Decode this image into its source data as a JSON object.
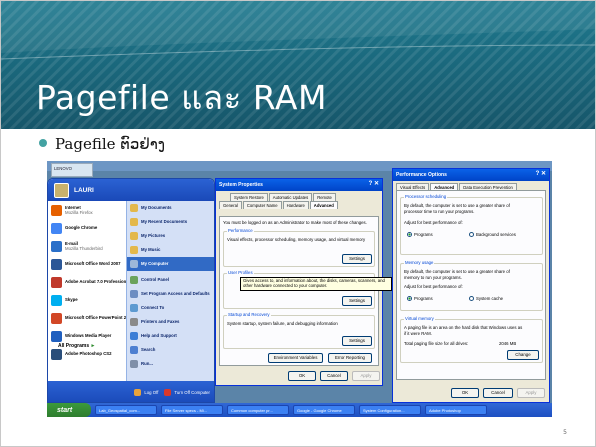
{
  "slide": {
    "title": "Pagefile และ RAM",
    "bullet": "Pagefile ຕົວຢ່າງ",
    "page_number": "5"
  },
  "desktop": {
    "logo_text": "LENOVO"
  },
  "start_menu": {
    "user": "LAURI",
    "pinned": [
      {
        "label": "Internet",
        "sub": "Mozilla Firefox",
        "color": "#e66000"
      },
      {
        "label": "Google Chrome",
        "sub": "",
        "color": "#4285f4"
      },
      {
        "label": "E-mail",
        "sub": "Mozilla Thunderbird",
        "color": "#2a6fc9"
      },
      {
        "label": "Microsoft Office Word 2007",
        "sub": "",
        "color": "#2b5797"
      },
      {
        "label": "Adobe Acrobat 7.0 Professional",
        "sub": "",
        "color": "#c0392b"
      },
      {
        "label": "Skype",
        "sub": "",
        "color": "#00aff0"
      },
      {
        "label": "Microsoft Office PowerPoint 2007",
        "sub": "",
        "color": "#d24726"
      },
      {
        "label": "Windows Media Player",
        "sub": "",
        "color": "#1f5fbf"
      },
      {
        "label": "Adobe Photoshop CS2",
        "sub": "",
        "color": "#2a4e7a"
      }
    ],
    "all_programs": "All Programs",
    "right_items": [
      "My Documents",
      "My Recent Documents",
      "My Pictures",
      "My Music",
      "My Computer",
      "Control Panel",
      "Set Program Access and Defaults",
      "Connect To",
      "Printers and Faxes",
      "Help and Support",
      "Search",
      "Run..."
    ],
    "log_off": "Log Off",
    "turn_off": "Turn Off Computer"
  },
  "tooltip": "Gives access to, and information about, the disks, cameras, scanners, and other hardware connected to your computer.",
  "system_properties": {
    "title": "System Properties",
    "tabs_row1": [
      "System Restore",
      "Automatic Updates",
      "Remote"
    ],
    "tabs_row2": [
      "General",
      "Computer Name",
      "Hardware",
      "Advanced"
    ],
    "admin_note": "You must be logged on as an Administrator to make most of these changes.",
    "performance_label": "Performance",
    "performance_text": "Visual effects, processor scheduling, memory usage, and virtual memory",
    "user_profiles_label": "User Profiles",
    "startup_label": "Startup and Recovery",
    "startup_text": "System startup, system failure, and debugging information",
    "settings": "Settings",
    "env_vars": "Environment Variables",
    "error_reporting": "Error Reporting",
    "ok": "OK",
    "cancel": "Cancel",
    "apply": "Apply"
  },
  "performance_options": {
    "title": "Performance Options",
    "tabs": [
      "Visual Effects",
      "Advanced",
      "Data Execution Prevention"
    ],
    "proc_label": "Processor scheduling",
    "proc_text_1": "By default, the computer is set to use a greater share of",
    "proc_text_2": "processor time to run your programs.",
    "adjust": "Adjust for best performance of:",
    "programs": "Programs",
    "background": "Background services",
    "mem_label": "Memory usage",
    "mem_text_1": "By default, the computer is set to use a greater share of",
    "mem_text_2": "memory to run your programs.",
    "system_cache": "System cache",
    "vm_label": "Virtual memory",
    "vm_text_1": "A paging file is an area on the hard disk that Windows uses as",
    "vm_text_2": "if it were RAM.",
    "vm_total_label": "Total paging file size for all drives:",
    "vm_total_value": "2046 MB",
    "change": "Change",
    "ok": "OK",
    "cancel": "Cancel",
    "apply": "Apply"
  },
  "taskbar": {
    "start": "start",
    "buttons": [
      "Lab_Geospatial_com...",
      "File Server specs - Mi...",
      "Common computer pr...",
      "Google - Google Chrome",
      "System Configuration...",
      "Adobe Photoshop"
    ]
  }
}
